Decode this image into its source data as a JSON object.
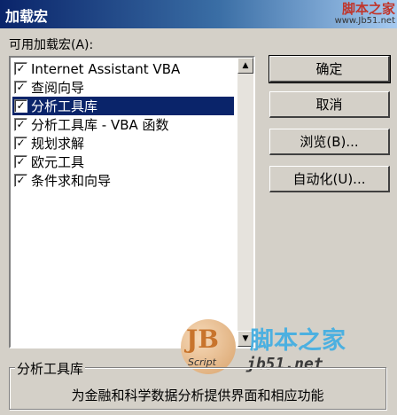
{
  "window": {
    "title": "加载宏"
  },
  "watermark_top": {
    "main": "脚本之家",
    "sub": "www.Jb51.net"
  },
  "addins": {
    "label": "可用加载宏(A):",
    "items": [
      {
        "label": "Internet Assistant VBA",
        "checked": true,
        "selected": false
      },
      {
        "label": "查阅向导",
        "checked": true,
        "selected": false
      },
      {
        "label": "分析工具库",
        "checked": true,
        "selected": true
      },
      {
        "label": "分析工具库 - VBA 函数",
        "checked": true,
        "selected": false
      },
      {
        "label": "规划求解",
        "checked": true,
        "selected": false
      },
      {
        "label": "欧元工具",
        "checked": true,
        "selected": false
      },
      {
        "label": "条件求和向导",
        "checked": true,
        "selected": false
      }
    ]
  },
  "buttons": {
    "ok": "确定",
    "cancel": "取消",
    "browse": "浏览(B)...",
    "automation": "自动化(U)..."
  },
  "description": {
    "title": "分析工具库",
    "text": "为金融和科学数据分析提供界面和相应功能"
  },
  "watermark_logo": {
    "mark": "JB",
    "script": "Script",
    "cn": "脚本之家",
    "url": "jb51.net"
  }
}
